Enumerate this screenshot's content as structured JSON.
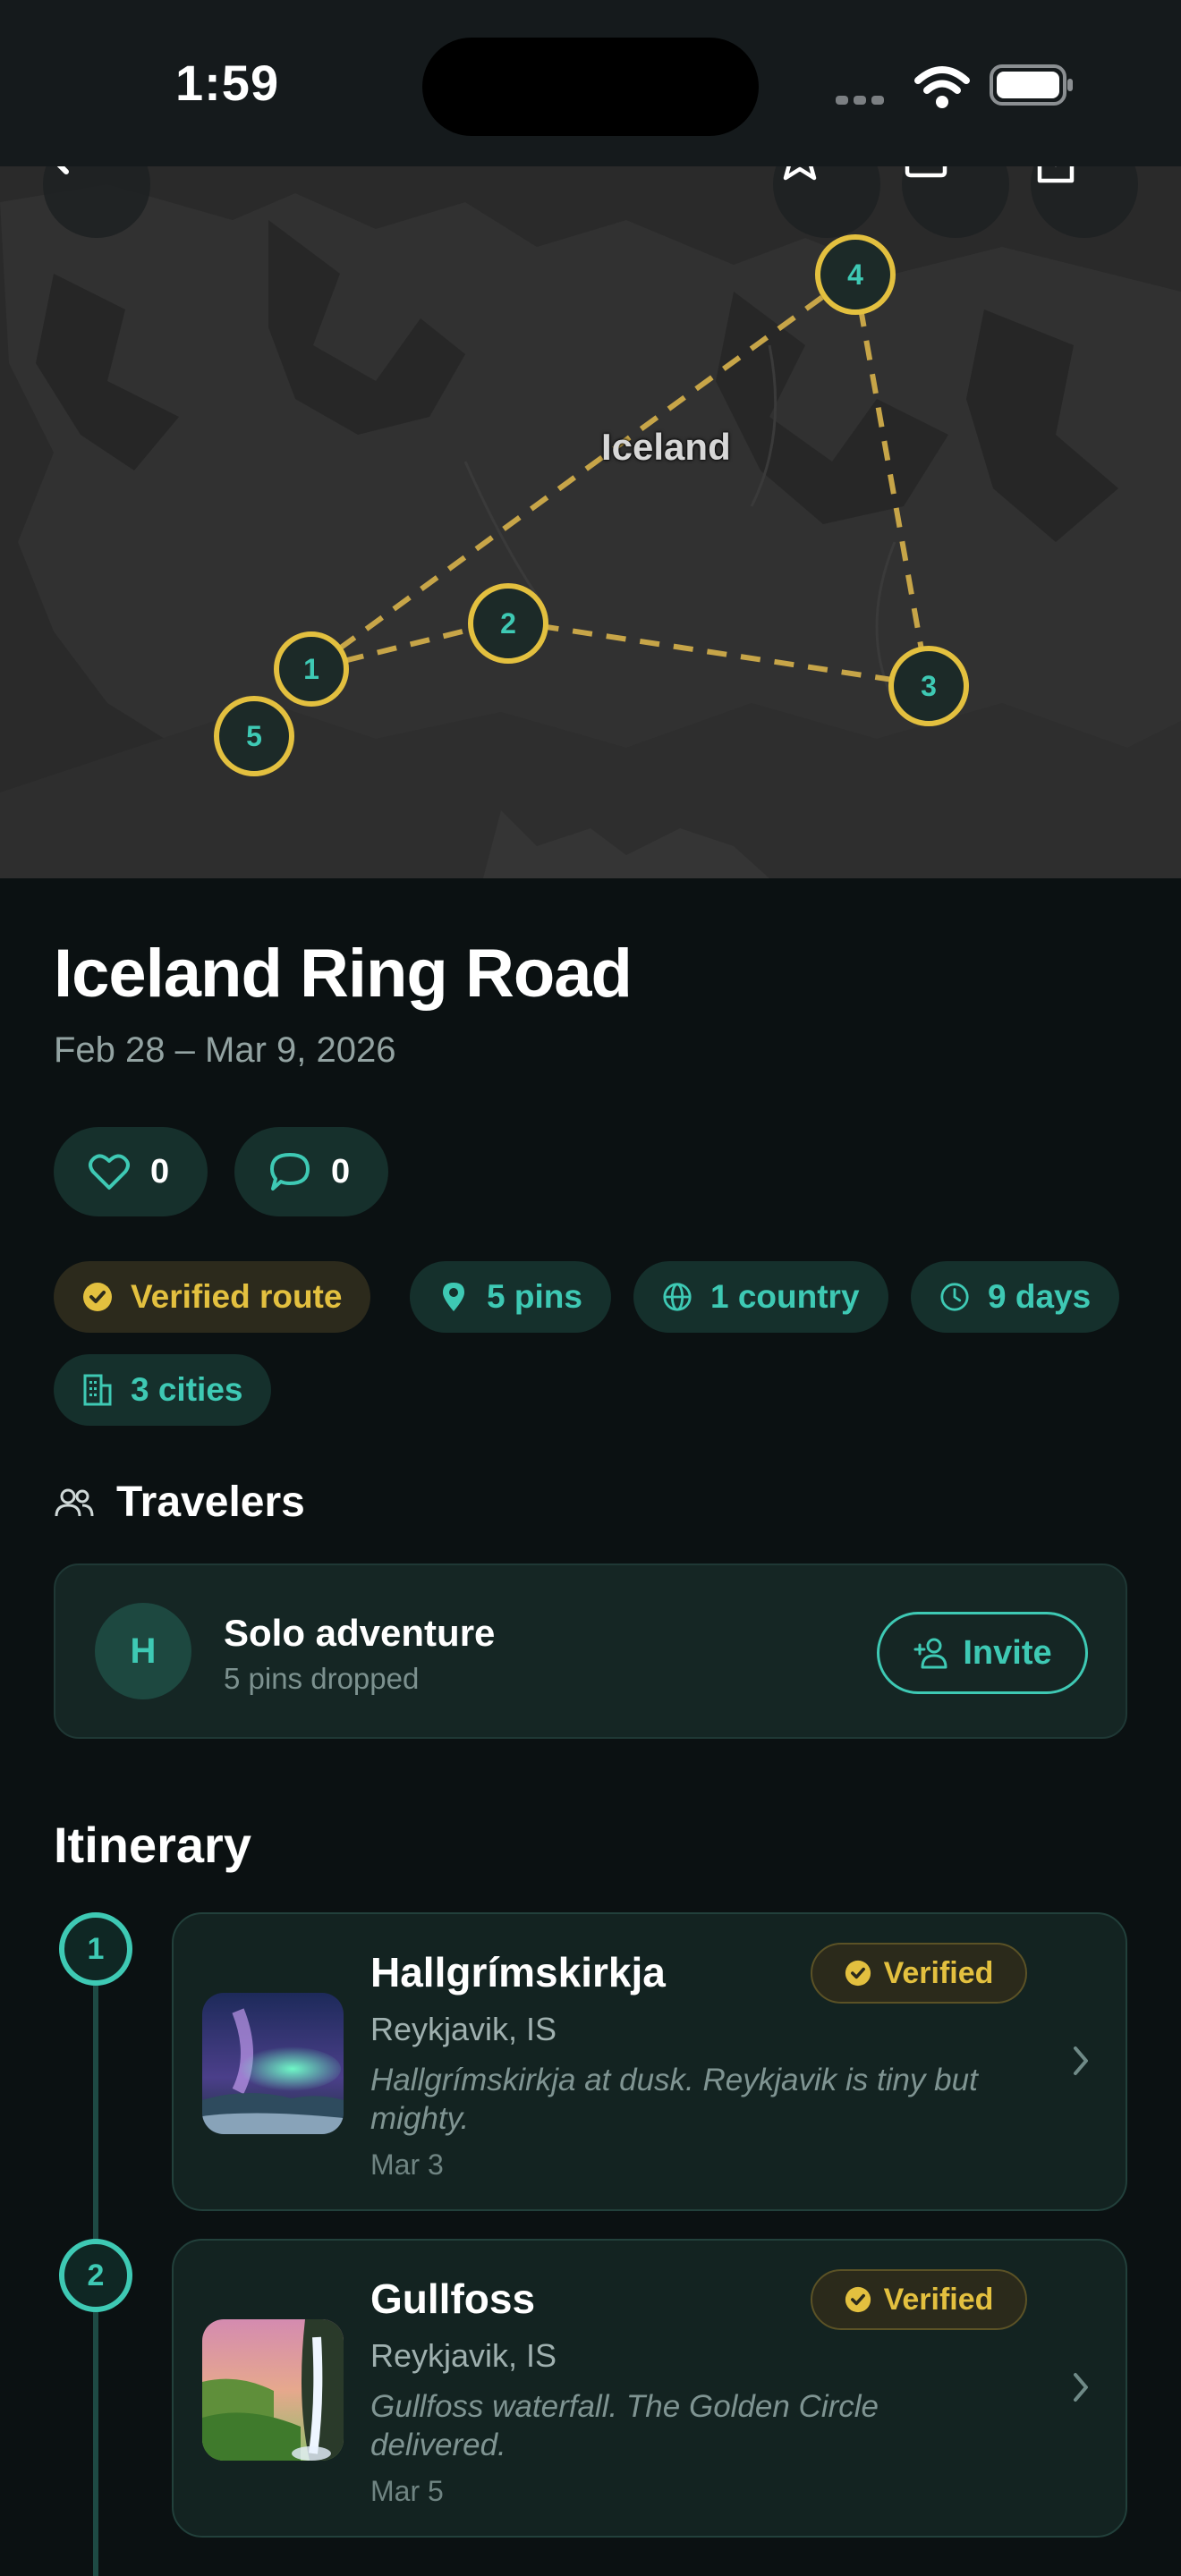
{
  "status_bar": {
    "time": "1:59"
  },
  "map": {
    "label": "Iceland",
    "pins": [
      "1",
      "2",
      "3",
      "4",
      "5"
    ]
  },
  "trip": {
    "title": "Iceland Ring Road",
    "dates": "Feb 28 – Mar 9, 2026",
    "likes": "0",
    "comments": "0"
  },
  "chips": {
    "verified": "Verified route",
    "pins": "5 pins",
    "country": "1 country",
    "days": "9 days",
    "cities": "3 cities"
  },
  "travelers": {
    "title": "Travelers",
    "avatar_initial": "H",
    "name": "Solo adventure",
    "subtitle": "5 pins dropped",
    "invite_label": "Invite"
  },
  "itinerary": {
    "title": "Itinerary",
    "stops": [
      {
        "number": "1",
        "name": "Hallgrímskirkja",
        "place": "Reykjavik, IS",
        "note": "Hallgrímskirkja at dusk. Reykjavik is tiny but mighty.",
        "date": "Mar 3",
        "badge": "Verified"
      },
      {
        "number": "2",
        "name": "Gullfoss",
        "place": "Reykjavik, IS",
        "note": "Gullfoss waterfall. The Golden Circle delivered.",
        "date": "Mar 5",
        "badge": "Verified"
      }
    ]
  },
  "colors": {
    "background": "#0b1112",
    "accent_teal": "#3ec9b4",
    "accent_gold": "#e3c03f",
    "route_line": "#c7a548"
  },
  "icons": [
    "back-arrow-icon",
    "star-icon",
    "edit-icon",
    "share-icon",
    "heart-icon",
    "comment-icon",
    "check-badge-icon",
    "pin-icon",
    "globe-icon",
    "clock-icon",
    "building-icon",
    "people-icon",
    "add-person-icon",
    "chevron-right-icon",
    "wifi-icon",
    "battery-icon"
  ]
}
